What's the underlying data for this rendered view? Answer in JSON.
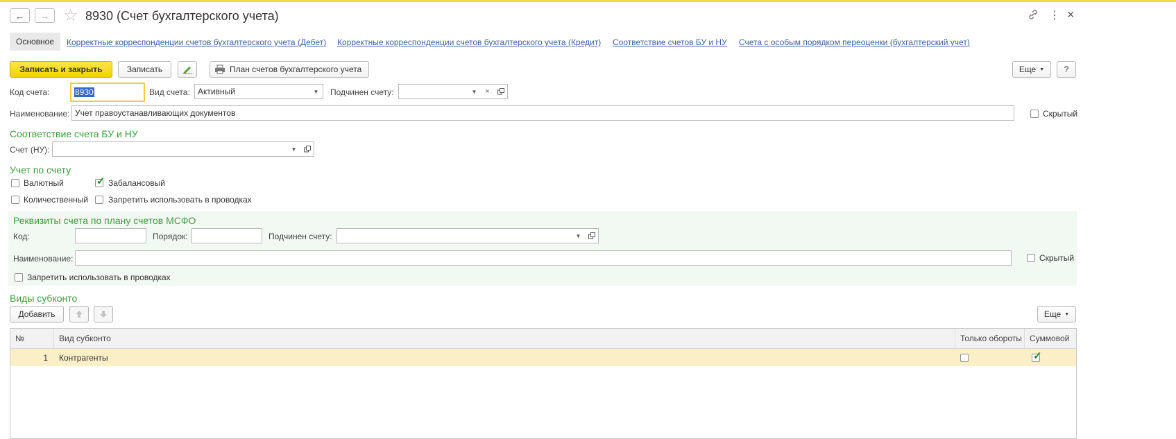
{
  "window": {
    "title": "8930 (Счет бухгалтерского учета)",
    "back_icon": "←",
    "forward_icon": "→",
    "star_icon": "☆",
    "link_icon": "🔗",
    "menu_icon": "⋮",
    "close_icon": "×"
  },
  "tabs": [
    {
      "label": "Основное"
    },
    {
      "label": "Корректные корреспонденции счетов бухгалтерского учета (Дебет)"
    },
    {
      "label": "Корректные корреспонденции счетов бухгалтерского учета (Кредит)"
    },
    {
      "label": "Соответствие счетов БУ и НУ"
    },
    {
      "label": "Счета с особым порядком переоценки (бухгалтерский учет)"
    }
  ],
  "toolbar": {
    "save_close": "Записать и закрыть",
    "save": "Записать",
    "print_plan": "План счетов бухгалтерского учета",
    "more": "Еще",
    "help": "?"
  },
  "form": {
    "code_label": "Код счета:",
    "code_value": "8930",
    "type_label": "Вид счета:",
    "type_value": "Активный",
    "parent_label": "Подчинен счету:",
    "parent_value": "",
    "name_label": "Наименование:",
    "name_value": "Учет правоустанавливающих документов",
    "hidden_label": "Скрытый",
    "hidden_checked": false
  },
  "nu_section": {
    "title": "Соответствие счета БУ и НУ",
    "account_label": "Счет (НУ):",
    "account_value": ""
  },
  "accounting_section": {
    "title": "Учет по счету",
    "currency_label": "Валютный",
    "currency_checked": false,
    "offbalance_label": "Забалансовый",
    "offbalance_checked": true,
    "quantity_label": "Количественный",
    "quantity_checked": false,
    "forbid_label": "Запретить использовать в проводках",
    "forbid_checked": false
  },
  "ifrs_section": {
    "title": "Реквизиты счета по плану счетов МСФО",
    "code_label": "Код:",
    "code_value": "",
    "order_label": "Порядок:",
    "order_value": "",
    "parent_label": "Подчинен счету:",
    "parent_value": "",
    "name_label": "Наименование:",
    "name_value": "",
    "hidden_label": "Скрытый",
    "hidden_checked": false,
    "forbid_label": "Запретить использовать в проводках",
    "forbid_checked": false
  },
  "subconto": {
    "title": "Виды субконто",
    "add": "Добавить",
    "more": "Еще",
    "columns": [
      "№",
      "Вид субконто",
      "Только обороты",
      "Суммовой"
    ],
    "rows": [
      {
        "num": "1",
        "kind": "Контрагенты",
        "turnover_only": false,
        "sum": true
      }
    ]
  },
  "colors": {
    "accent_yellow": "#f2d200",
    "section_green": "#3b9c3b",
    "link_blue": "#3a62a7",
    "row_selected": "#fbefc8"
  }
}
